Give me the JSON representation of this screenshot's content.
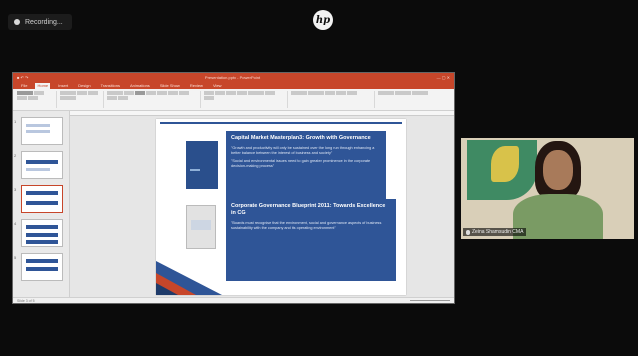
{
  "recording": {
    "label": "Recording..."
  },
  "overlay": {
    "logo_text": "hp"
  },
  "ppt": {
    "window_title": "Presentation.pptx - PowerPoint",
    "tabs": [
      "File",
      "Home",
      "Insert",
      "Design",
      "Transitions",
      "Animations",
      "Slide Show",
      "Review",
      "View"
    ],
    "active_tab": "Home",
    "slide_numbers": [
      "1",
      "2",
      "3",
      "4",
      "5"
    ],
    "status_left": "Slide 3 of 5",
    "status_right": "",
    "slide": {
      "box1_title": "Capital Market Masterplan3: Growth with Governance",
      "box1_p1": "\"Growth and productivity will only be sustained over the long run through enhancing a better balance between the interest of business and society\"",
      "box1_p2": "\"Social and environmental issues need to gain greater prominence in the corporate decision-making process\"",
      "box2_title": "Corporate Governance Blueprint 2011: Towards Excellence in CG",
      "box2_p1": "\"Boards must recognise that the environment, social and governance aspects of business sustainability with the company and its operating environment\""
    }
  },
  "webcam": {
    "participant_name": "Zeina Shamsudin CMA"
  }
}
